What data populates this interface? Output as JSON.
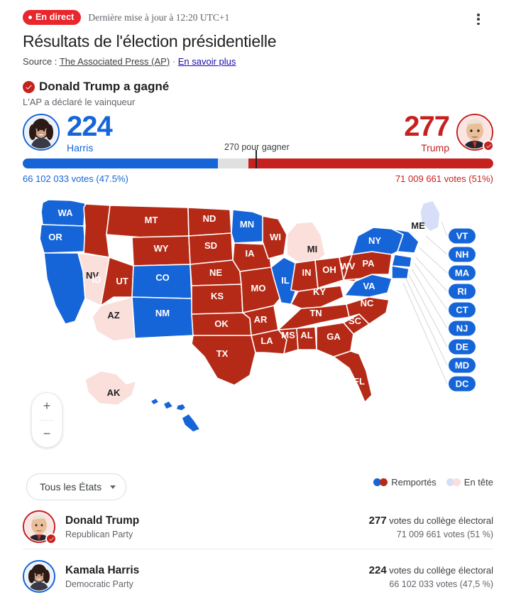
{
  "header": {
    "live_label": "En direct",
    "updated": "Dernière mise à jour à 12:20 UTC+1",
    "menu_icon": "more-vertical-icon",
    "title": "Résultats de l'élection présidentielle",
    "source_prefix": "Source :",
    "source_name": "The Associated Press (AP)",
    "source_sep": "·",
    "learn_more": "En savoir plus"
  },
  "winner": {
    "text": "Donald Trump a gagné",
    "subtext": "L'AP a déclaré le vainqueur",
    "check_icon": "check-circle-icon"
  },
  "scoreboard": {
    "to_win": "270 pour gagner",
    "left": {
      "votes": "224",
      "name": "Harris",
      "popular": "66 102 033 votes (47.5%)",
      "color": "#1565D8",
      "bar_percent": 41.5
    },
    "right": {
      "votes": "277",
      "name": "Trump",
      "popular": "71 009 661 votes (51%)",
      "color": "#C5221F",
      "bar_percent": 52.0
    },
    "tick_percent": 49.5
  },
  "map": {
    "zoom_in": "+",
    "zoom_out": "−",
    "zoom_in_icon": "plus-icon",
    "zoom_out_icon": "minus-icon",
    "colors": {
      "won_dem": "#1565D8",
      "won_gop": "#B52A17",
      "lead_dem": "#D7DEF7",
      "lead_gop": "#FADFDB",
      "border": "#ffffff"
    },
    "states": [
      {
        "code": "WA",
        "status": "won_dem"
      },
      {
        "code": "OR",
        "status": "won_dem"
      },
      {
        "code": "CA",
        "status": "won_dem"
      },
      {
        "code": "NV",
        "status": "lead_gop"
      },
      {
        "code": "ID",
        "status": "won_gop"
      },
      {
        "code": "MT",
        "status": "won_gop"
      },
      {
        "code": "WY",
        "status": "won_gop"
      },
      {
        "code": "UT",
        "status": "won_gop"
      },
      {
        "code": "AZ",
        "status": "lead_gop"
      },
      {
        "code": "CO",
        "status": "won_dem"
      },
      {
        "code": "NM",
        "status": "won_dem"
      },
      {
        "code": "ND",
        "status": "won_gop"
      },
      {
        "code": "SD",
        "status": "won_gop"
      },
      {
        "code": "NE",
        "status": "won_gop"
      },
      {
        "code": "KS",
        "status": "won_gop"
      },
      {
        "code": "OK",
        "status": "won_gop"
      },
      {
        "code": "TX",
        "status": "won_gop"
      },
      {
        "code": "MN",
        "status": "won_dem"
      },
      {
        "code": "IA",
        "status": "won_gop"
      },
      {
        "code": "MO",
        "status": "won_gop"
      },
      {
        "code": "AR",
        "status": "won_gop"
      },
      {
        "code": "LA",
        "status": "won_gop"
      },
      {
        "code": "WI",
        "status": "won_gop"
      },
      {
        "code": "IL",
        "status": "won_dem"
      },
      {
        "code": "MS",
        "status": "won_gop"
      },
      {
        "code": "AL",
        "status": "won_gop"
      },
      {
        "code": "MI",
        "status": "lead_gop"
      },
      {
        "code": "IN",
        "status": "won_gop"
      },
      {
        "code": "KY",
        "status": "won_gop"
      },
      {
        "code": "TN",
        "status": "won_gop"
      },
      {
        "code": "GA",
        "status": "won_gop"
      },
      {
        "code": "FL",
        "status": "won_gop"
      },
      {
        "code": "OH",
        "status": "won_gop"
      },
      {
        "code": "WV",
        "status": "won_gop"
      },
      {
        "code": "SC",
        "status": "won_gop"
      },
      {
        "code": "NC",
        "status": "won_gop"
      },
      {
        "code": "VA",
        "status": "won_dem"
      },
      {
        "code": "PA",
        "status": "won_gop"
      },
      {
        "code": "NY",
        "status": "won_dem"
      },
      {
        "code": "ME",
        "status": "lead_dem"
      },
      {
        "code": "AK",
        "status": "lead_gop"
      },
      {
        "code": "HI",
        "status": "won_dem"
      }
    ],
    "callouts": [
      {
        "code": "VT",
        "status": "won_dem"
      },
      {
        "code": "NH",
        "status": "won_dem"
      },
      {
        "code": "MA",
        "status": "won_dem"
      },
      {
        "code": "RI",
        "status": "won_dem"
      },
      {
        "code": "CT",
        "status": "won_dem"
      },
      {
        "code": "NJ",
        "status": "won_dem"
      },
      {
        "code": "DE",
        "status": "won_dem"
      },
      {
        "code": "MD",
        "status": "won_dem"
      },
      {
        "code": "DC",
        "status": "won_dem"
      }
    ]
  },
  "controls": {
    "state_filter": "Tous les États",
    "caret_icon": "chevron-down-icon",
    "legend": [
      {
        "label": "Remportés",
        "colors": [
          "#1565D8",
          "#B52A17"
        ]
      },
      {
        "label": "En tête",
        "colors": [
          "#D7DEF7",
          "#FADFDB"
        ]
      }
    ]
  },
  "candidates": [
    {
      "name": "Donald Trump",
      "party": "Republican Party",
      "electoral_votes": "277",
      "electoral_label": "votes du collège électoral",
      "popular": "71 009 661 votes (51 %)",
      "color": "#C5221F",
      "winner": true
    },
    {
      "name": "Kamala Harris",
      "party": "Democratic Party",
      "electoral_votes": "224",
      "electoral_label": "votes du collège électoral",
      "popular": "66 102 033 votes (47,5 %)",
      "color": "#1565D8",
      "winner": false
    }
  ]
}
